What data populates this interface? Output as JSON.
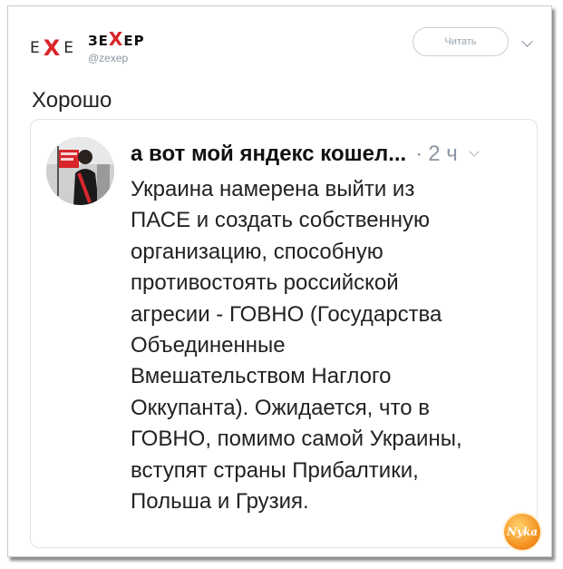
{
  "header": {
    "logo_left": "E",
    "logo_mid": "X",
    "logo_right": "E",
    "account_name_left": "ЗЕ",
    "account_name_x": "Х",
    "account_name_right": "ЕР",
    "account_handle": "@zexep",
    "follow_button": "Читать"
  },
  "tweet": {
    "text": "Хорошо"
  },
  "quoted_tweet": {
    "author": "а вот мой яндекс кошел...",
    "separator": "·",
    "time": "2 ч",
    "lines": [
      "Украина намерена выйти из",
      "ПАСЕ и создать собственную",
      "организацию, способную",
      "противостоять российской",
      "агресии - ГОВНО (Государства",
      "Объединенные",
      "Вмешательством Наглого",
      "Оккупанта). Ожидается, что в",
      "ГОВНО, помимо самой Украины,",
      "вступят страны Прибалтики,",
      "Польша и Грузия."
    ]
  },
  "watermark": {
    "text": "Nyka"
  },
  "colors": {
    "accent_red": "#d9252a",
    "muted": "#8a96a3",
    "border": "#dfe3e7"
  },
  "icons": [
    "chevron-down-icon",
    "avatar-photo"
  ]
}
